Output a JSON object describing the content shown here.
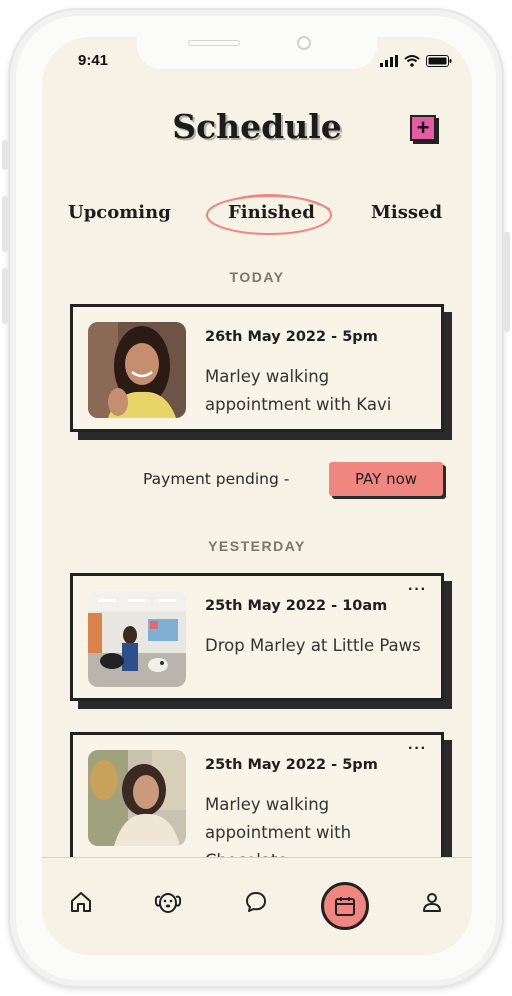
{
  "status_bar": {
    "time": "9:41"
  },
  "header": {
    "title": "Schedule",
    "add_label": "+"
  },
  "tabs": [
    {
      "label": "Upcoming"
    },
    {
      "label": "Finished",
      "active": true
    },
    {
      "label": "Missed"
    }
  ],
  "sections": [
    {
      "label": "TODAY",
      "cards": [
        {
          "date": "26th May 2022 - 5pm",
          "description": "Marley walking appointment with Kavi",
          "photo": "woman-smiling-portrait"
        }
      ],
      "payment": {
        "text": "Payment pending -",
        "button": "PAY now"
      }
    },
    {
      "label": "YESTERDAY",
      "cards": [
        {
          "date": "25th May 2022 - 10am",
          "description": "Drop Marley at Little Paws",
          "photo": "dog-daycare-room",
          "more": "···"
        },
        {
          "date": "25th May 2022 - 5pm",
          "description": "Marley walking appointment with Chocolate",
          "photo": "woman-outdoors-portrait",
          "more": "···"
        }
      ]
    }
  ],
  "tab_bar": {
    "items": [
      {
        "icon": "home-icon"
      },
      {
        "icon": "dog-icon"
      },
      {
        "icon": "chat-icon"
      },
      {
        "icon": "calendar-icon",
        "active": true
      },
      {
        "icon": "profile-icon"
      }
    ]
  },
  "colors": {
    "background": "#f7f2e6",
    "accent": "#ef8680",
    "add_button": "#e75aa4",
    "ink": "#222222"
  }
}
